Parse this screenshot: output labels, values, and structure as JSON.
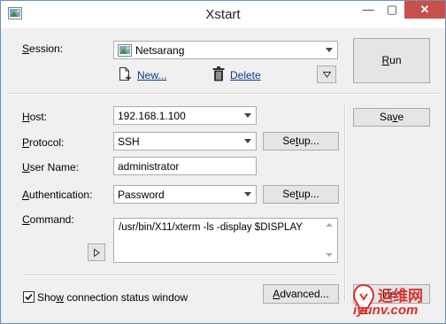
{
  "window": {
    "title": "Xstart",
    "close_glyph": "✕",
    "min_glyph": "—",
    "max_glyph": "▢"
  },
  "session": {
    "label_u": "S",
    "label_rest": "ession:",
    "value": "Netsarang",
    "new_label_u": "N",
    "new_label_rest": "ew...",
    "delete_label_u": "D",
    "delete_label_rest": "elete"
  },
  "buttons": {
    "run_u": "R",
    "run_rest": "un",
    "save_pre": "Sa",
    "save_u": "v",
    "save_rest": "e",
    "protocol_setup_pre": "Se",
    "protocol_setup_u": "t",
    "protocol_setup_rest": "up...",
    "auth_setup_pre": "Se",
    "auth_setup_u": "t",
    "auth_setup_rest": "up...",
    "advanced_u": "A",
    "advanced_rest": "dvanced...",
    "help_partial": "He"
  },
  "form": {
    "host_u": "H",
    "host_rest": "ost:",
    "host_value": "192.168.1.100",
    "protocol_u": "P",
    "protocol_rest": "rotocol:",
    "protocol_value": "SSH",
    "username_u": "U",
    "username_rest": "ser Name:",
    "username_value": "administrator",
    "auth_u": "A",
    "auth_rest": "uthentication:",
    "auth_value": "Password",
    "command_u": "C",
    "command_rest": "ommand:",
    "command_value": "/usr/bin/X11/xterm -ls -display $DISPLAY"
  },
  "status": {
    "checked": true,
    "pre": "Sho",
    "u": "w",
    "rest": " connection status window"
  },
  "watermark": {
    "text_top": "运维网",
    "text_bottom": "iyunv.com"
  },
  "colors": {
    "close": "#c7504a",
    "watermark_red": "#d9302b"
  }
}
